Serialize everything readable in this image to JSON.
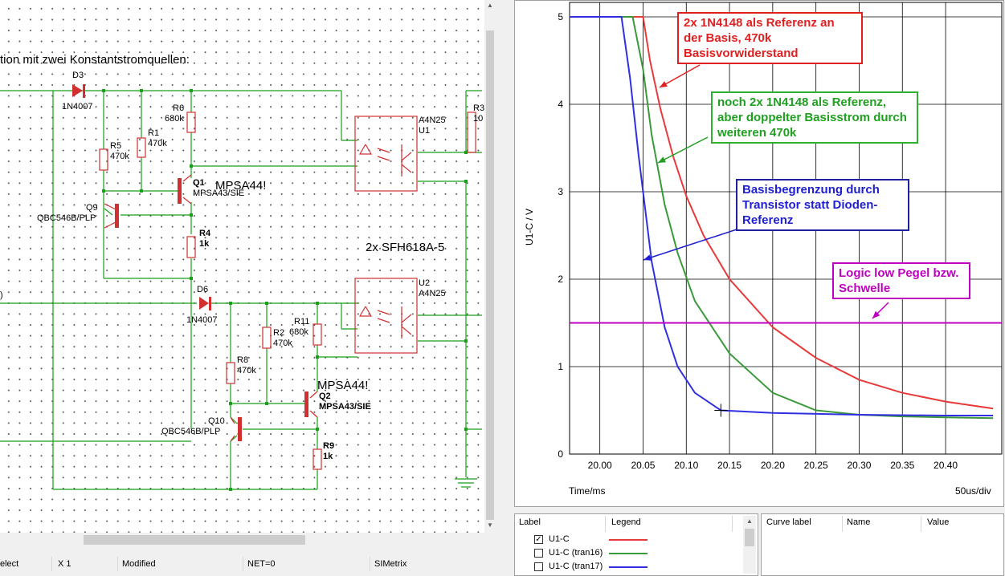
{
  "schematic": {
    "header_text": "tion mit zwei Konstantstromquellen:",
    "note_text": "2x SFH618A-5",
    "edge_text": ")",
    "components": {
      "d3_ref": "D3",
      "d3_val": "1N4007",
      "r6_ref": "R6",
      "r6_val": "680k",
      "r5_ref": "R5",
      "r5_val": "470k",
      "r1_ref": "R1",
      "r1_val": "470k",
      "q1_ref": "Q1",
      "q1_val": "MPSA43/SIE",
      "q1_note": "MPSA44!",
      "q9_ref": "Q9",
      "q9_val": "QBC546B/PLP",
      "r4_ref": "R4",
      "r4_val": "1k",
      "u1_ref": "U1",
      "u1_val": "A4N25",
      "r3_ref": "R3",
      "r3_val": "10",
      "d6_ref": "D6",
      "d6_val": "1N4007",
      "u2_ref": "U2",
      "u2_val": "A4N25",
      "r11_ref": "R11",
      "r11_val": "680k",
      "r2_ref": "R2",
      "r2_val": "470k",
      "r8_ref": "R8",
      "r8_val": "470k",
      "q2_ref": "Q2",
      "q2_val": "MPSA43/SIE",
      "q2_note": "MPSA44!",
      "q10_ref": "Q10",
      "q10_val": "QBC546B/PLP",
      "r9_ref": "R9",
      "r9_val": "1k"
    }
  },
  "statusbar": {
    "mode": "elect",
    "zoom": "X 1",
    "state": "Modified",
    "net": "NET=0",
    "app": "SIMetrix"
  },
  "graph": {
    "ylabel": "U1-C / V",
    "xlabel": "Time/ms",
    "xscale_label": "50us/div",
    "yticks": [
      "0",
      "1",
      "2",
      "3",
      "4",
      "5"
    ],
    "xticks": [
      "20.00",
      "20.05",
      "20.10",
      "20.15",
      "20.20",
      "20.25",
      "20.30",
      "20.35",
      "20.40"
    ],
    "annotations": {
      "red": "2x 1N4148 als Referenz an der Basis, 470k Basisvorwiderstand",
      "green": "noch 2x 1N4148 als Referenz, aber doppelter Basisstrom durch weiteren 470k",
      "blue": "Basisbegrenzung durch Transistor statt Dioden-Referenz",
      "magenta": "Logic low Pegel bzw. Schwelle"
    },
    "colors": {
      "red": "#e83a3a",
      "green": "#3a9a3a",
      "blue": "#3030e0",
      "magenta": "#c000c0"
    }
  },
  "legend": {
    "col_label": "Label",
    "col_legend": "Legend",
    "rows": [
      {
        "label": "U1-C",
        "checked": true,
        "color": "#e83a3a"
      },
      {
        "label": "U1-C (tran16)",
        "checked": false,
        "color": "#3a9a3a"
      },
      {
        "label": "U1-C (tran17)",
        "checked": false,
        "color": "#3030e0"
      }
    ]
  },
  "curve_info": {
    "col_curve_label": "Curve label",
    "col_name": "Name",
    "col_value": "Value"
  },
  "chart_data": {
    "type": "line",
    "xlabel": "Time/ms",
    "ylabel": "U1-C / V",
    "xlim": [
      19.965,
      20.465
    ],
    "ylim": [
      0,
      5
    ],
    "x_ticks": [
      20.0,
      20.05,
      20.1,
      20.15,
      20.2,
      20.25,
      20.3,
      20.35,
      20.4
    ],
    "y_ticks": [
      0,
      1,
      2,
      3,
      4,
      5
    ],
    "grid": true,
    "series": [
      {
        "name": "U1-C",
        "color": "#e83a3a",
        "x": [
          19.965,
          20.05,
          20.058,
          20.07,
          20.085,
          20.1,
          20.12,
          20.15,
          20.2,
          20.25,
          20.3,
          20.35,
          20.4,
          20.455
        ],
        "y": [
          5.0,
          5.0,
          4.5,
          3.95,
          3.4,
          2.95,
          2.5,
          2.0,
          1.45,
          1.1,
          0.85,
          0.7,
          0.6,
          0.52
        ]
      },
      {
        "name": "U1-C (tran16)",
        "color": "#3a9a3a",
        "x": [
          19.965,
          20.038,
          20.05,
          20.06,
          20.075,
          20.09,
          20.11,
          20.15,
          20.2,
          20.25,
          20.3,
          20.35,
          20.4,
          20.455
        ],
        "y": [
          5.0,
          5.0,
          4.4,
          3.65,
          2.85,
          2.3,
          1.75,
          1.15,
          0.7,
          0.5,
          0.45,
          0.43,
          0.42,
          0.41
        ]
      },
      {
        "name": "U1-C (tran17)",
        "color": "#3030e0",
        "x": [
          19.965,
          20.025,
          20.035,
          20.045,
          20.06,
          20.075,
          20.09,
          20.11,
          20.14,
          20.2,
          20.3,
          20.4,
          20.455
        ],
        "y": [
          5.0,
          5.0,
          4.3,
          3.4,
          2.2,
          1.45,
          1.0,
          0.7,
          0.5,
          0.47,
          0.45,
          0.44,
          0.44
        ]
      },
      {
        "name": "Logic low Pegel bzw. Schwelle",
        "color": "#c000c0",
        "x": [
          19.965,
          20.465
        ],
        "y": [
          1.5,
          1.5
        ]
      }
    ]
  }
}
